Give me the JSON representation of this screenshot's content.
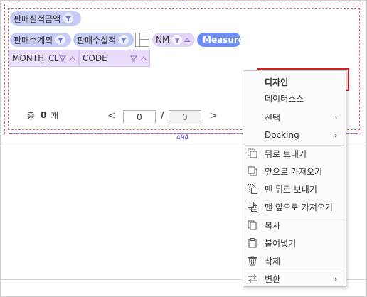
{
  "width_label": "494",
  "row_field": {
    "label": "판매실적금액"
  },
  "column_fields": [
    {
      "label": "판매수계획"
    },
    {
      "label": "판매수실적"
    }
  ],
  "value_field": {
    "label": "NM"
  },
  "measures_label": "Measures",
  "grid_headers": [
    {
      "label": "MONTH_CD"
    },
    {
      "label": "CODE"
    }
  ],
  "pager": {
    "total_prefix": "총",
    "total_count": "0",
    "total_suffix": "개",
    "prev": "<",
    "current_page": "0",
    "slash": "/",
    "total_pages": "0",
    "next": ">"
  },
  "context_menu": {
    "items": [
      {
        "label": "디자인",
        "icon": "",
        "submenu": false,
        "active": true
      },
      {
        "label": "데이터소스",
        "icon": "",
        "submenu": false
      },
      {
        "label": "선택",
        "icon": "",
        "submenu": true
      },
      {
        "label": "Docking",
        "icon": "",
        "submenu": true
      },
      {
        "label": "뒤로 보내기",
        "icon": "send-backward-icon",
        "submenu": false
      },
      {
        "label": "앞으로 가져오기",
        "icon": "bring-forward-icon",
        "submenu": false
      },
      {
        "label": "맨 뒤로 보내기",
        "icon": "send-to-back-icon",
        "submenu": false
      },
      {
        "label": "맨 앞으로 가져오기",
        "icon": "bring-to-front-icon",
        "submenu": false
      },
      {
        "label": "복사",
        "icon": "copy-icon",
        "submenu": false
      },
      {
        "label": "붙여넣기",
        "icon": "paste-icon",
        "submenu": false
      },
      {
        "label": "삭제",
        "icon": "trash-icon",
        "submenu": false
      },
      {
        "label": "변환",
        "icon": "convert-icon",
        "submenu": true
      }
    ],
    "submenu_arrow": "›"
  },
  "colors": {
    "pill_blue": "#c5cdf5",
    "pill_purple": "#e2d4f6",
    "measures": "#6f8ef0",
    "highlight_border": "#d81c1c",
    "selection_guide": "#d07070"
  }
}
